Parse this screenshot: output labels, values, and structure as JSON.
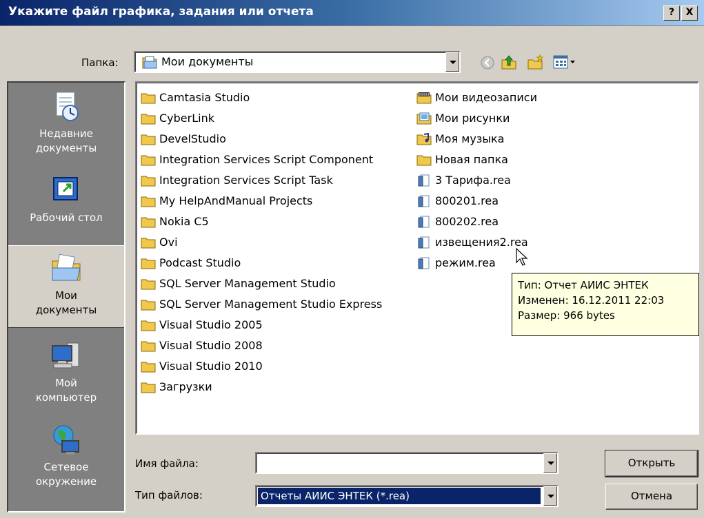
{
  "window": {
    "title": "Укажите файл графика, задания или отчета",
    "help_label": "?",
    "close_label": "X"
  },
  "folder": {
    "label": "Папка:",
    "current": "Мои документы"
  },
  "places": [
    {
      "label_line1": "Недавние",
      "label_line2": "документы",
      "icon": "recent-documents-icon"
    },
    {
      "label_line1": "Рабочий стол",
      "label_line2": "",
      "icon": "desktop-icon"
    },
    {
      "label_line1": "Мои",
      "label_line2": "документы",
      "icon": "my-documents-icon"
    },
    {
      "label_line1": "Мой",
      "label_line2": "компьютер",
      "icon": "my-computer-icon"
    },
    {
      "label_line1": "Сетевое",
      "label_line2": "окружение",
      "icon": "network-icon"
    }
  ],
  "files": {
    "column1": [
      "Camtasia Studio",
      "CyberLink",
      "DevelStudio",
      "Integration Services Script Component",
      "Integration Services Script Task",
      "My HelpAndManual Projects",
      "Nokia C5",
      "Ovi",
      "Podcast Studio",
      "SQL Server Management Studio",
      "SQL Server Management Studio Express",
      "Visual Studio 2005",
      "Visual Studio 2008",
      "Visual Studio 2010",
      "Загрузки"
    ],
    "column2": [
      {
        "name": "Мои видеозаписи",
        "icon": "video-folder-icon"
      },
      {
        "name": "Мои рисунки",
        "icon": "pictures-folder-icon"
      },
      {
        "name": "Моя музыка",
        "icon": "music-folder-icon"
      },
      {
        "name": "Новая папка",
        "icon": "folder-icon"
      },
      {
        "name": "3 Тарифа.rea",
        "icon": "rea-file-icon"
      },
      {
        "name": "800201.rea",
        "icon": "rea-file-icon"
      },
      {
        "name": "800202.rea",
        "icon": "rea-file-icon"
      },
      {
        "name": "извещения2.rea",
        "icon": "rea-file-icon"
      },
      {
        "name": "режим.rea",
        "icon": "rea-file-icon"
      }
    ]
  },
  "tooltip": {
    "line1": "Тип: Отчет АИИС ЭНТЕК",
    "line2": "Изменен: 16.12.2011 22:03",
    "line3": "Размер: 966 bytes"
  },
  "filename": {
    "label": "Имя файла:",
    "value": ""
  },
  "filetype": {
    "label": "Тип файлов:",
    "value": "Отчеты АИИС ЭНТЕК (*.rea)"
  },
  "buttons": {
    "open": "Открыть",
    "cancel": "Отмена"
  },
  "colors": {
    "titlebar": "#0a246a",
    "dialog_bg": "#d4d0c8",
    "places_bg": "#808080",
    "selection": "#0a246a",
    "tooltip_bg": "#ffffe1",
    "folder_yellow": "#f0c84a"
  }
}
